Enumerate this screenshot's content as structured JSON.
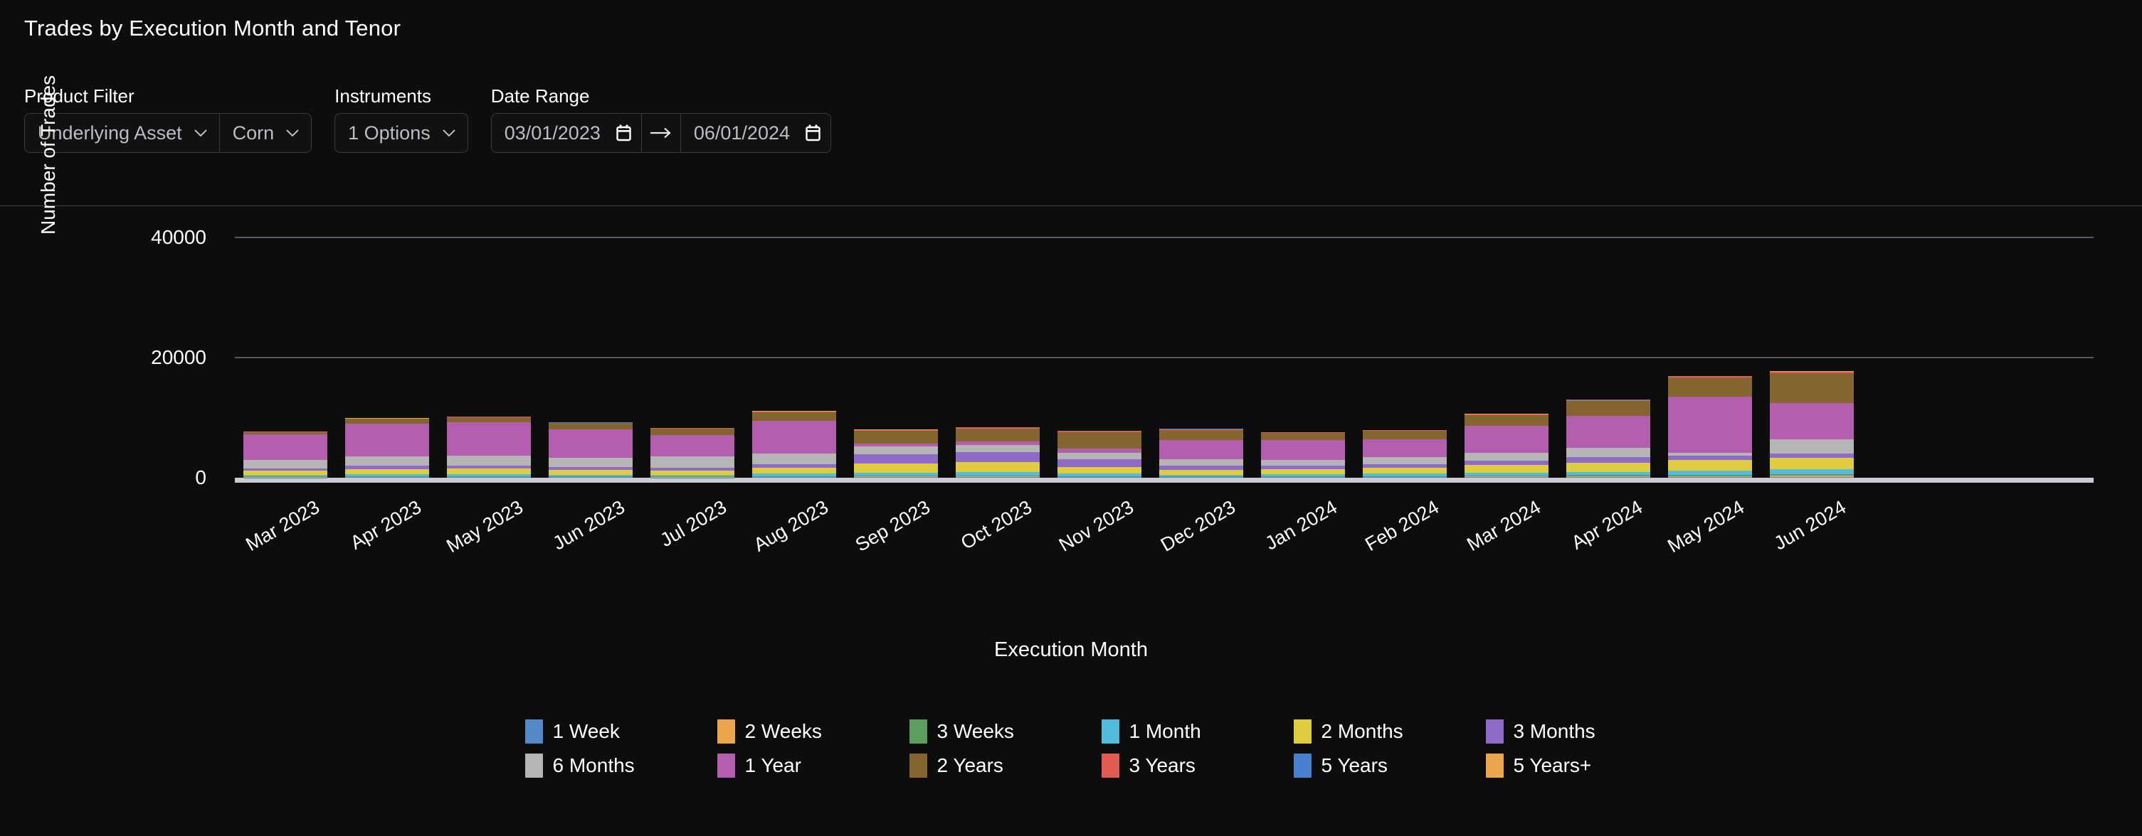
{
  "header": {
    "title": "Trades by Execution Month and Tenor"
  },
  "filters": {
    "product_filter": {
      "label": "Product Filter",
      "dimension_value": "Underlying Asset",
      "value": "Corn",
      "chevron_icon": "chevron-down-icon"
    },
    "instruments": {
      "label": "Instruments",
      "value": "1 Options",
      "chevron_icon": "chevron-down-icon"
    },
    "date_range": {
      "label": "Date Range",
      "start": "03/01/2023",
      "end": "06/01/2024",
      "separator_icon": "arrow-right-icon",
      "calendar_icon": "calendar-icon"
    }
  },
  "chart_data": {
    "type": "bar",
    "stacked": true,
    "title": "Trades by Execution Month and Tenor",
    "xlabel": "Execution Month",
    "ylabel": "Number of Trades",
    "ylim": [
      0,
      45000
    ],
    "yticks": [
      0,
      20000,
      40000
    ],
    "ytick_labels": [
      "0",
      "20000",
      "40000"
    ],
    "grid": true,
    "legend_position": "bottom",
    "categories": [
      "Mar 2023",
      "Apr 2023",
      "May 2023",
      "Jun 2023",
      "Jul 2023",
      "Aug 2023",
      "Sep 2023",
      "Oct 2023",
      "Nov 2023",
      "Dec 2023",
      "Jan 2024",
      "Feb 2024",
      "Mar 2024",
      "Apr 2024",
      "May 2024",
      "Jun 2024"
    ],
    "series": [
      {
        "name": "1 Week",
        "color": "#5588c7",
        "values": [
          60,
          70,
          80,
          70,
          60,
          90,
          110,
          120,
          90,
          70,
          80,
          90,
          110,
          130,
          150,
          170
        ]
      },
      {
        "name": "2 Weeks",
        "color": "#eda54b",
        "values": [
          50,
          60,
          60,
          55,
          50,
          70,
          90,
          100,
          70,
          55,
          60,
          70,
          85,
          100,
          120,
          140
        ]
      },
      {
        "name": "3 Weeks",
        "color": "#5d9e5f",
        "values": [
          90,
          110,
          120,
          100,
          90,
          130,
          170,
          190,
          130,
          100,
          110,
          130,
          160,
          190,
          230,
          260
        ]
      },
      {
        "name": "1 Month",
        "color": "#52bcdb",
        "values": [
          260,
          340,
          360,
          300,
          270,
          400,
          520,
          580,
          400,
          300,
          340,
          400,
          490,
          580,
          700,
          800
        ]
      },
      {
        "name": "2 Months",
        "color": "#e0cc3f",
        "values": [
          700,
          880,
          900,
          820,
          760,
          1000,
          1450,
          1600,
          1100,
          820,
          880,
          1000,
          1250,
          1450,
          1750,
          1900
        ]
      },
      {
        "name": "3 Months",
        "color": "#8e6bc8",
        "values": [
          330,
          520,
          520,
          480,
          420,
          620,
          1600,
          1700,
          1300,
          620,
          520,
          620,
          800,
          950,
          720,
          800
        ]
      },
      {
        "name": "6 Months",
        "color": "#b5b5b5",
        "values": [
          1450,
          1600,
          1650,
          1450,
          1900,
          1700,
          1250,
          1200,
          1100,
          1100,
          1000,
          1100,
          1300,
          1550,
          500,
          2300
        ]
      },
      {
        "name": "1 Year",
        "color": "#b35eae",
        "values": [
          4300,
          5400,
          5500,
          4800,
          3600,
          5500,
          500,
          600,
          700,
          3200,
          3300,
          3000,
          4400,
          5300,
          9300,
          6100
        ]
      },
      {
        "name": "2 Years",
        "color": "#84652f",
        "values": [
          400,
          800,
          900,
          1000,
          1000,
          1400,
          2100,
          2100,
          2700,
          1700,
          1200,
          1400,
          1800,
          2500,
          3200,
          4900
        ]
      },
      {
        "name": "3 Years",
        "color": "#e05b52",
        "values": [
          60,
          80,
          90,
          100,
          90,
          120,
          160,
          170,
          200,
          130,
          110,
          120,
          150,
          180,
          220,
          260
        ]
      },
      {
        "name": "5 Years",
        "color": "#4a7fd0",
        "values": [
          20,
          25,
          30,
          25,
          20,
          35,
          45,
          50,
          55,
          35,
          30,
          35,
          45,
          50,
          60,
          70
        ]
      },
      {
        "name": "5 Years+",
        "color": "#eda54b",
        "values": [
          10,
          12,
          14,
          12,
          10,
          16,
          20,
          22,
          24,
          16,
          14,
          16,
          20,
          24,
          28,
          32
        ]
      }
    ],
    "totals": [
      7730,
      9896,
      10224,
      9212,
      8270,
      11081,
      8016,
      8432,
      7876,
      8148,
      7644,
      7981,
      10610,
      13007,
      16980,
      17732
    ]
  },
  "legend": {
    "rows": [
      [
        {
          "label": "1 Week",
          "color": "#5588c7"
        },
        {
          "label": "2 Weeks",
          "color": "#eda54b"
        },
        {
          "label": "3 Weeks",
          "color": "#5d9e5f"
        },
        {
          "label": "1 Month",
          "color": "#52bcdb"
        },
        {
          "label": "2 Months",
          "color": "#e0cc3f"
        },
        {
          "label": "3 Months",
          "color": "#8e6bc8"
        }
      ],
      [
        {
          "label": "6 Months",
          "color": "#b5b5b5"
        },
        {
          "label": "1 Year",
          "color": "#b35eae"
        },
        {
          "label": "2 Years",
          "color": "#84652f"
        },
        {
          "label": "3 Years",
          "color": "#e05b52"
        },
        {
          "label": "5 Years",
          "color": "#4a7fd0"
        },
        {
          "label": "5 Years+",
          "color": "#eda54b"
        }
      ]
    ]
  },
  "theme": {
    "background": "#0d0d0d",
    "grid_color": "#555a69",
    "axis_color": "#c9ccd1",
    "text_color": "#ffffff",
    "muted_text": "#b9bec6",
    "border_color": "#3a3a3a"
  }
}
